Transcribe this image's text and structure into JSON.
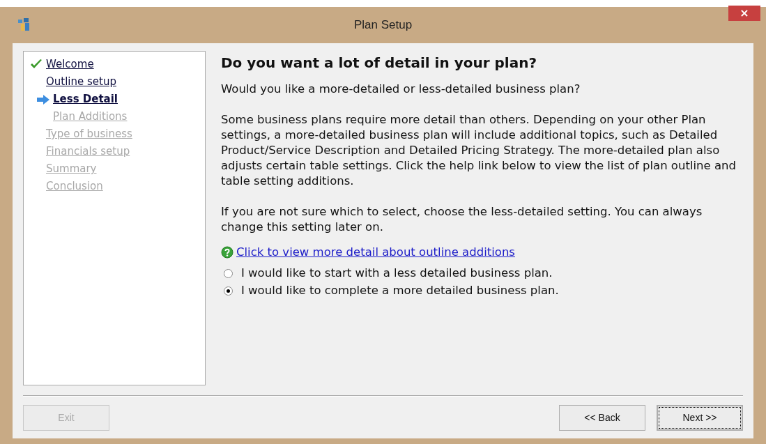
{
  "window": {
    "title": "Plan Setup",
    "close": "×"
  },
  "sidebar": {
    "items": [
      {
        "label": "Welcome",
        "checked": true,
        "selected": false,
        "disabled": false
      },
      {
        "label": "Outline setup",
        "checked": false,
        "selected": false,
        "disabled": false,
        "children": [
          {
            "label": "Less Detail",
            "checked": false,
            "selected": true,
            "disabled": false
          },
          {
            "label": "Plan Additions",
            "checked": false,
            "selected": false,
            "disabled": true
          }
        ]
      },
      {
        "label": "Type of business",
        "checked": false,
        "selected": false,
        "disabled": true
      },
      {
        "label": "Financials setup",
        "checked": false,
        "selected": false,
        "disabled": true
      },
      {
        "label": "Summary",
        "checked": false,
        "selected": false,
        "disabled": true
      },
      {
        "label": "Conclusion",
        "checked": false,
        "selected": false,
        "disabled": true
      }
    ]
  },
  "heading": "Do you want a lot of detail in your plan?",
  "paragraphs": [
    "Would you like a more-detailed or less-detailed business plan?",
    "Some business plans require more detail than others. Depending on your other Plan settings, a more-detailed business plan will include additional topics, such as Detailed Product/Service Description and Detailed Pricing Strategy. The more-detailed plan also adjusts certain table settings. Click the help link below to view the list of plan outline and table setting additions.",
    "If you are not sure which to select, choose the less-detailed setting. You can always change this setting later on."
  ],
  "help_link": "Click to view more detail about outline additions",
  "options": [
    {
      "label": "I would like to start with a less detailed business plan.",
      "selected": false
    },
    {
      "label": "I would like to complete a more detailed business plan.",
      "selected": true
    }
  ],
  "buttons": [
    {
      "label": "Exit",
      "disabled": true,
      "default": false
    },
    {
      "label": "<< Back",
      "disabled": false,
      "default": false
    },
    {
      "label": "Next >>",
      "disabled": false,
      "default": true
    }
  ]
}
